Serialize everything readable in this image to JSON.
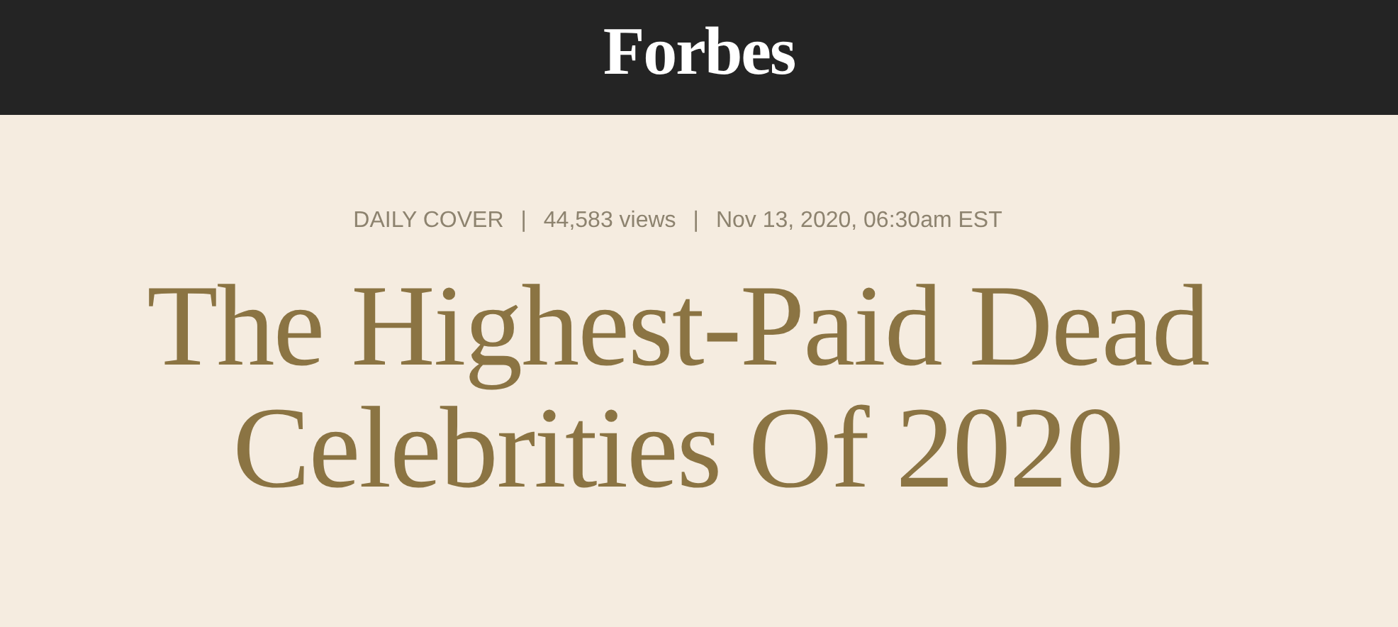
{
  "header": {
    "logo": "Forbes"
  },
  "meta": [
    "DAILY COVER",
    "44,583 views",
    "Nov 13, 2020, 06:30am EST"
  ],
  "separator": "|",
  "headline": "The Highest-Paid Dead Celebrities Of 2020"
}
